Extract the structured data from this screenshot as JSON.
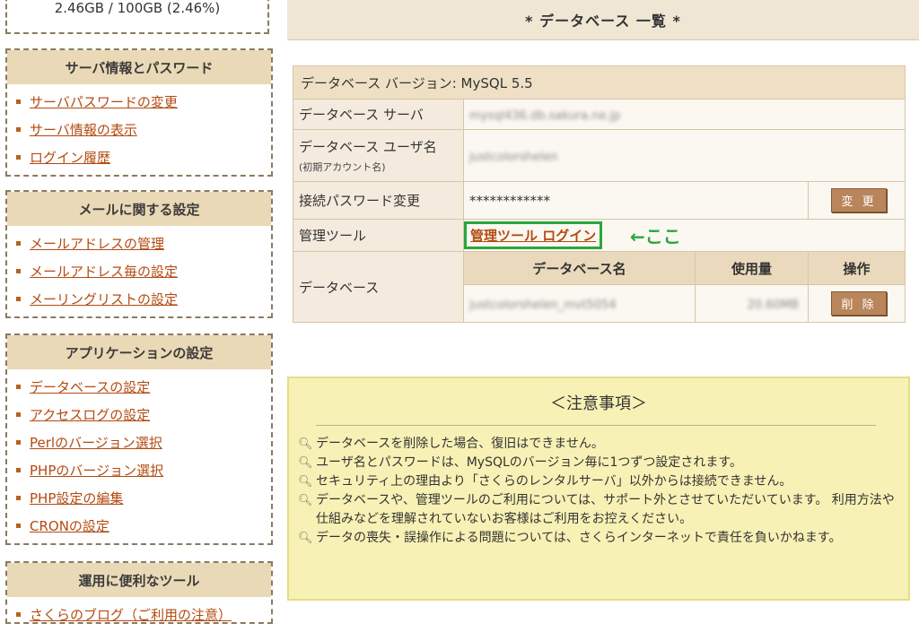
{
  "sidebar": {
    "disk_usage": "2.46GB / 100GB (2.46%)",
    "sections": [
      {
        "title": "サーバ情報とパスワード",
        "items": [
          "サーバパスワードの変更",
          "サーバ情報の表示",
          "ログイン履歴"
        ]
      },
      {
        "title": "メールに関する設定",
        "items": [
          "メールアドレスの管理",
          "メールアドレス毎の設定",
          "メーリングリストの設定"
        ]
      },
      {
        "title": "アプリケーションの設定",
        "items": [
          "データベースの設定",
          "アクセスログの設定",
          "Perlのバージョン選択",
          "PHPのバージョン選択",
          "PHP設定の編集",
          "CRONの設定"
        ]
      },
      {
        "title": "運用に便利なツール",
        "items": [
          "さくらのブログ（ご利用の注意）"
        ]
      }
    ]
  },
  "main": {
    "title": "* データベース 一覧 *",
    "version_label": "データベース バージョン: MySQL 5.5",
    "server_label": "データベース サーバ",
    "server_value": "mysql436.db.sakura.ne.jp",
    "user_label": "データベース ユーザ名",
    "user_sublabel": "(初期アカウント名)",
    "user_value": "justcolorshelen",
    "password_label": "接続パスワード変更",
    "password_value": "************",
    "change_button": "変 更",
    "tool_label": "管理ツール",
    "tool_link": "管理ツール ログイン",
    "tool_annotation": "←ここ",
    "database_label": "データベース",
    "db_columns": [
      "データベース名",
      "使用量",
      "操作"
    ],
    "db_rows": [
      {
        "name": "justcolorshelen_mvt5054",
        "usage": "20.60MB",
        "action": "削 除"
      }
    ]
  },
  "notice": {
    "title": "＜注意事項＞",
    "items": [
      "データベースを削除した場合、復旧はできません。",
      "ユーザ名とパスワードは、MySQLのバージョン毎に1つずつ設定されます。",
      "セキュリティ上の理由より「さくらのレンタルサーバ」以外からは接続できません。",
      "データベースや、管理ツールのご利用については、サポート外とさせていただいています。 利用方法や仕組みなどを理解されていないお客様はご利用をお控えください。",
      "データの喪失・誤操作による問題については、さくらインターネットで責任を負いかねます。"
    ]
  },
  "colors": {
    "accent_link": "#b44a10",
    "highlight_green": "#2aa63b",
    "notice_bg": "#f8f1b5",
    "header_bg": "#ead9b6"
  }
}
